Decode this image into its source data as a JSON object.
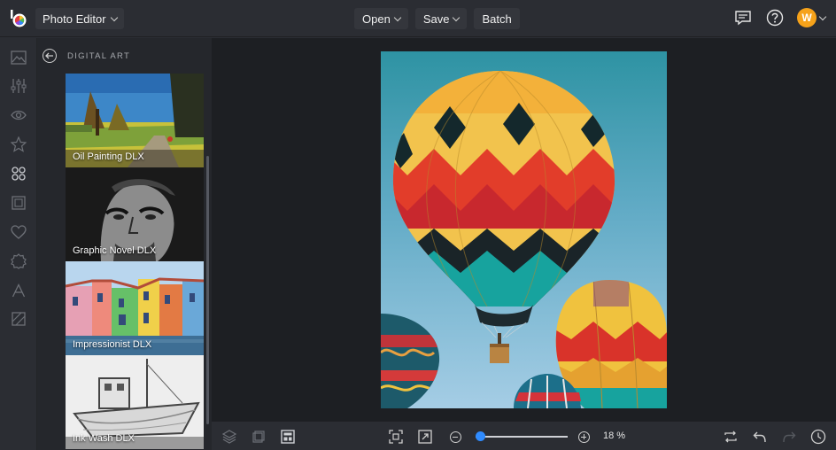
{
  "header": {
    "app_menu_label": "Photo Editor",
    "open_label": "Open",
    "save_label": "Save",
    "batch_label": "Batch",
    "avatar_initial": "W"
  },
  "rail": {
    "items": [
      "image-icon",
      "sliders-icon",
      "eye-icon",
      "star-icon",
      "effects-icon",
      "frame-icon",
      "heart-icon",
      "texture-icon",
      "text-icon",
      "pattern-icon"
    ]
  },
  "panel": {
    "title": "DIGITAL ART",
    "effects": [
      {
        "label": "Oil Painting DLX",
        "selected": false
      },
      {
        "label": "Graphic Novel DLX",
        "selected": false
      },
      {
        "label": "Impressionist DLX",
        "selected": true
      },
      {
        "label": "Ink Wash DLX",
        "selected": false
      }
    ]
  },
  "bottom": {
    "zoom_label": "18 %",
    "zoom_level": 0.05
  },
  "colors": {
    "accent_selected": "#e5175e",
    "avatar": "#f6a21a",
    "slider": "#2f8bff"
  }
}
